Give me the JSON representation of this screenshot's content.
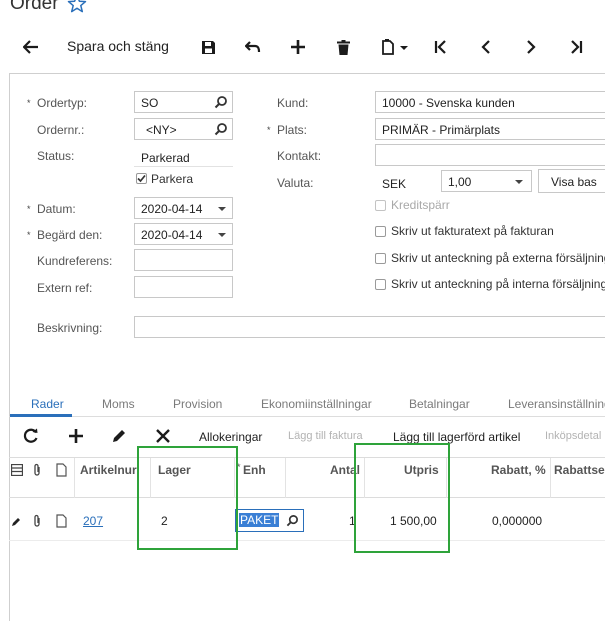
{
  "header": {
    "title": "Order"
  },
  "toolbar": {
    "save_close_label": "Spara och stäng"
  },
  "form": {
    "ordertyp": {
      "label": "Ordertyp:",
      "value": "SO"
    },
    "ordernr": {
      "label": "Ordernr.:",
      "value": "<NY>"
    },
    "status": {
      "label": "Status:",
      "value": "Parkerad"
    },
    "parkera": {
      "label": "Parkera",
      "checked": true
    },
    "datum": {
      "label": "Datum:",
      "value": "2020-04-14"
    },
    "begard": {
      "label": "Begärd den:",
      "value": "2020-04-14"
    },
    "kundreferens": {
      "label": "Kundreferens:",
      "value": ""
    },
    "externref": {
      "label": "Extern ref:",
      "value": ""
    },
    "kund": {
      "label": "Kund:",
      "value": "10000 - Svenska kunden"
    },
    "plats": {
      "label": "Plats:",
      "value": "PRIMÄR - Primärplats"
    },
    "kontakt": {
      "label": "Kontakt:",
      "value": ""
    },
    "valuta": {
      "label": "Valuta:",
      "currency": "SEK",
      "rate": "1,00",
      "button": "Visa bas"
    },
    "checkboxes": [
      {
        "label": "Kreditspärr",
        "disabled": true
      },
      {
        "label": "Skriv ut fakturatext på fakturan"
      },
      {
        "label": "Skriv ut anteckning på externa försäljning"
      },
      {
        "label": "Skriv ut anteckning på interna försäljnings"
      }
    ],
    "beskrivning": {
      "label": "Beskrivning:",
      "value": ""
    }
  },
  "tabs": [
    "Rader",
    "Moms",
    "Provision",
    "Ekonomiinställningar",
    "Betalningar",
    "Leveransinställning"
  ],
  "grid_toolbar": {
    "allokeringar": "Allokeringar",
    "lagg_till_faktura": "Lägg till faktura",
    "lagg_till_lagerford": "Lägg till lagerförd artikel",
    "inkopsdetal": "Inköpsdetal"
  },
  "grid": {
    "columns": [
      "Artikelnur",
      "Lager",
      "Enh",
      "Antal",
      "Utpris",
      "Rabatt, %",
      "Rabattsel"
    ],
    "rows": [
      {
        "artikelnr": "207",
        "lager": "2",
        "enh": "PAKET",
        "antal": "1",
        "utpris": "1 500,00",
        "rabatt": "0,000000",
        "rabattsel": ""
      }
    ]
  },
  "colors": {
    "accent": "#2a6fba",
    "highlight": "#2ea33a"
  }
}
